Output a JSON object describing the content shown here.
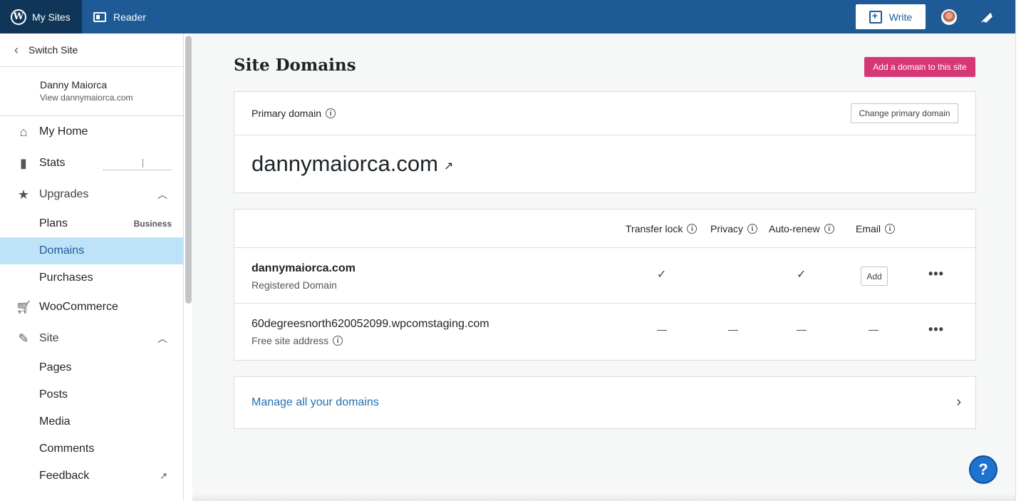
{
  "masterbar": {
    "my_sites": "My Sites",
    "reader": "Reader",
    "write": "Write"
  },
  "sidebar": {
    "switch_site": "Switch Site",
    "site_name": "Danny Maiorca",
    "site_url": "View dannymaiorca.com",
    "items": {
      "my_home": "My Home",
      "stats": "Stats",
      "upgrades": "Upgrades",
      "plans": "Plans",
      "plans_badge": "Business",
      "domains": "Domains",
      "purchases": "Purchases",
      "woocommerce": "WooCommerce",
      "site": "Site",
      "pages": "Pages",
      "posts": "Posts",
      "media": "Media",
      "comments": "Comments",
      "feedback": "Feedback"
    }
  },
  "main": {
    "title": "Site Domains",
    "add_domain_button": "Add a domain to this site",
    "primary": {
      "label": "Primary domain",
      "change_button": "Change primary domain",
      "domain": "dannymaiorca.com"
    },
    "table": {
      "headers": {
        "transfer_lock": "Transfer lock",
        "privacy": "Privacy",
        "auto_renew": "Auto-renew",
        "email": "Email"
      },
      "rows": [
        {
          "name": "dannymaiorca.com",
          "type": "Registered Domain",
          "transfer_lock": "✓",
          "privacy": "",
          "auto_renew": "✓",
          "email_button": "Add",
          "more": "•••"
        },
        {
          "name": "60degreesnorth620052099.wpcomstaging.com",
          "type": "Free site address",
          "transfer_lock": "—",
          "privacy": "—",
          "auto_renew": "—",
          "email": "—",
          "more": "•••"
        }
      ]
    },
    "manage_link": "Manage all your domains",
    "help": "?"
  },
  "colors": {
    "masterbar": "#1e5a96",
    "my_sites_bg": "#0f3658",
    "accent_pink": "#d63877",
    "active_item": "#bee3f8",
    "link": "#2271b1"
  }
}
